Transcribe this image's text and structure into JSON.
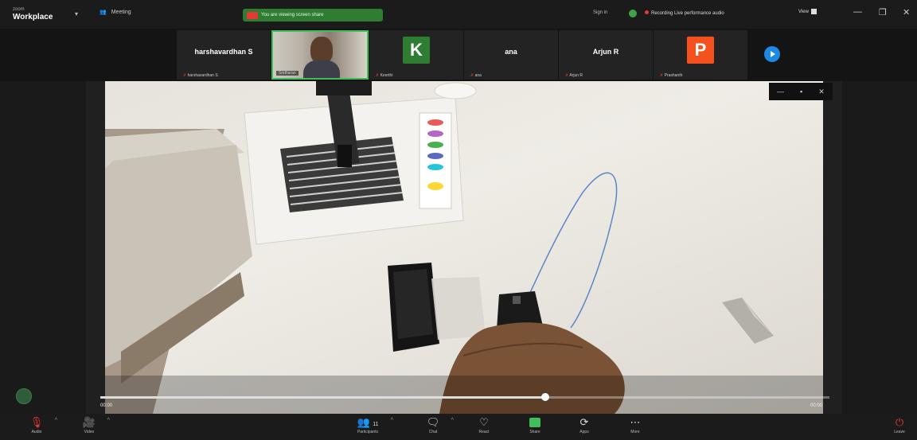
{
  "titlebar": {
    "brand_top": "zoom",
    "brand_name": "Workplace",
    "meeting_label": "Meeting",
    "share_text": "You are viewing screen share",
    "sign_in": "Sign in",
    "recording_text": "Recording  Live performance audio",
    "view_label": "View"
  },
  "participants": [
    {
      "type": "name",
      "name": "harshavardhan S",
      "caption": "harshavardhan S"
    },
    {
      "type": "video",
      "caption": "Sridharan"
    },
    {
      "type": "avatar",
      "initial": "K",
      "color": "#2e7d32",
      "caption": "Keerthi"
    },
    {
      "type": "name",
      "name": "ana",
      "caption": "ana"
    },
    {
      "type": "name",
      "name": "Arjun R",
      "caption": "Arjun R"
    },
    {
      "type": "avatar",
      "initial": "P",
      "color": "#f4511e",
      "caption": "Prashanth"
    }
  ],
  "media": {
    "time_current": "00:00",
    "time_total": "00:00",
    "progress": 0.61
  },
  "toolbar": {
    "audio": "Audio",
    "video": "Video",
    "participants": "Participants",
    "participants_count": "11",
    "chat": "Chat",
    "react": "React",
    "share": "Share",
    "apps": "Apps",
    "more": "More",
    "leave": "Leave"
  }
}
